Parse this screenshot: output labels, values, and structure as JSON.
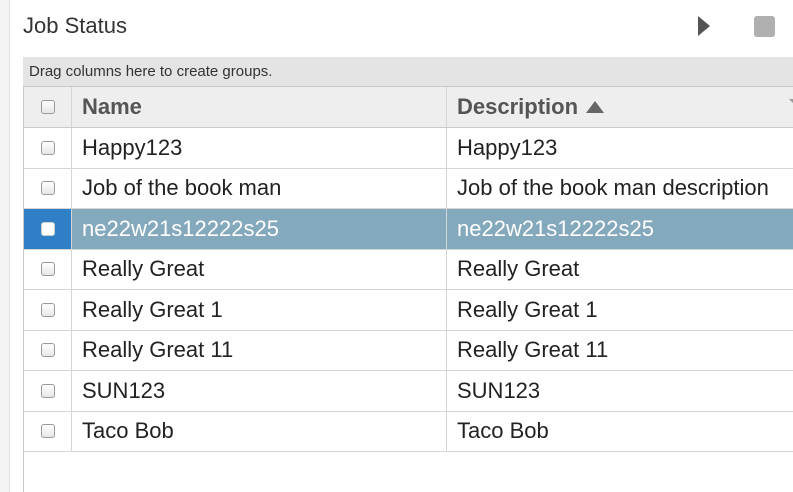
{
  "panel": {
    "title": "Job Status"
  },
  "toolbar": {
    "play_icon": "play-icon",
    "stop_icon": "stop-icon"
  },
  "grid": {
    "group_hint": "Drag columns here to create groups.",
    "columns": {
      "name": "Name",
      "description": "Description",
      "sort_direction": "ascending"
    },
    "selected_index": 2,
    "rows": [
      {
        "name": "Happy123",
        "description": "Happy123"
      },
      {
        "name": "Job of the book man",
        "description": "Job of the book man description"
      },
      {
        "name": "ne22w21s12222s25",
        "description": "ne22w21s12222s25"
      },
      {
        "name": "Really Great",
        "description": "Really Great"
      },
      {
        "name": "Really Great 1",
        "description": "Really Great 1"
      },
      {
        "name": "Really Great 11",
        "description": "Really Great 11"
      },
      {
        "name": "SUN123",
        "description": "SUN123"
      },
      {
        "name": "Taco Bob",
        "description": "Taco Bob"
      }
    ]
  },
  "colors": {
    "selected_row": "#84a9bd",
    "selected_check_cell": "#2f7fc6",
    "header_bg": "#eeeeee",
    "group_bar_bg": "#e4e4e4"
  }
}
